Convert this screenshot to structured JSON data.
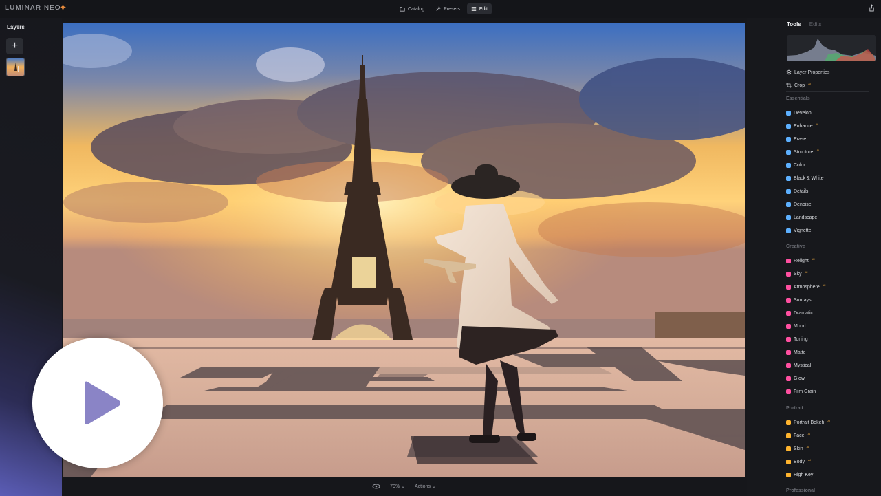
{
  "app": {
    "logo_main": "LUMINAR",
    "logo_sub": "NEO"
  },
  "nav": {
    "catalog": "Catalog",
    "presets": "Presets",
    "edit": "Edit"
  },
  "layers": {
    "title": "Layers",
    "add_label": "+"
  },
  "bottom": {
    "zoom": "79%",
    "actions": "Actions"
  },
  "tabs": {
    "tools": "Tools",
    "edits": "Edits"
  },
  "tools": {
    "layer_properties": "Layer Properties",
    "crop": "Crop",
    "ai_badge": "AI",
    "essentials_title": "Essentials",
    "essentials": [
      {
        "label": "Develop",
        "icon": "develop-icon",
        "color": "#5db0ff",
        "ai": false
      },
      {
        "label": "Enhance",
        "icon": "enhance-icon",
        "color": "#5db0ff",
        "ai": true
      },
      {
        "label": "Erase",
        "icon": "erase-icon",
        "color": "#5db0ff",
        "ai": false
      },
      {
        "label": "Structure",
        "icon": "structure-icon",
        "color": "#5db0ff",
        "ai": true
      },
      {
        "label": "Color",
        "icon": "color-icon",
        "color": "#5db0ff",
        "ai": false
      },
      {
        "label": "Black & White",
        "icon": "bw-icon",
        "color": "#5db0ff",
        "ai": false
      },
      {
        "label": "Details",
        "icon": "details-icon",
        "color": "#5db0ff",
        "ai": false
      },
      {
        "label": "Denoise",
        "icon": "denoise-icon",
        "color": "#5db0ff",
        "ai": false
      },
      {
        "label": "Landscape",
        "icon": "landscape-icon",
        "color": "#5db0ff",
        "ai": false
      },
      {
        "label": "Vignette",
        "icon": "vignette-icon",
        "color": "#5db0ff",
        "ai": false
      }
    ],
    "creative_title": "Creative",
    "creative": [
      {
        "label": "Relight",
        "icon": "relight-icon",
        "color": "#ff4fa0",
        "ai": true
      },
      {
        "label": "Sky",
        "icon": "sky-icon",
        "color": "#ff4fa0",
        "ai": true
      },
      {
        "label": "Atmosphere",
        "icon": "atmosphere-icon",
        "color": "#ff4fa0",
        "ai": true
      },
      {
        "label": "Sunrays",
        "icon": "sunrays-icon",
        "color": "#ff4fa0",
        "ai": false
      },
      {
        "label": "Dramatic",
        "icon": "dramatic-icon",
        "color": "#ff4fa0",
        "ai": false
      },
      {
        "label": "Mood",
        "icon": "mood-icon",
        "color": "#ff4fa0",
        "ai": false
      },
      {
        "label": "Toning",
        "icon": "toning-icon",
        "color": "#ff4fa0",
        "ai": false
      },
      {
        "label": "Matte",
        "icon": "matte-icon",
        "color": "#ff4fa0",
        "ai": false
      },
      {
        "label": "Mystical",
        "icon": "mystical-icon",
        "color": "#ff4fa0",
        "ai": false
      },
      {
        "label": "Glow",
        "icon": "glow-icon",
        "color": "#ff4fa0",
        "ai": false
      },
      {
        "label": "Film Grain",
        "icon": "film-grain-icon",
        "color": "#ff4fa0",
        "ai": false
      }
    ],
    "portrait_title": "Portrait",
    "portrait": [
      {
        "label": "Portrait Bokeh",
        "icon": "portrait-bokeh-icon",
        "color": "#ffb42e",
        "ai": true
      },
      {
        "label": "Face",
        "icon": "face-icon",
        "color": "#ffb42e",
        "ai": true
      },
      {
        "label": "Skin",
        "icon": "skin-icon",
        "color": "#ffb42e",
        "ai": true
      },
      {
        "label": "Body",
        "icon": "body-icon",
        "color": "#ffb42e",
        "ai": true
      },
      {
        "label": "High Key",
        "icon": "high-key-icon",
        "color": "#ffb42e",
        "ai": false
      }
    ],
    "professional_title": "Professional"
  },
  "colors": {
    "accent_ai": "#e9a840",
    "panel": "#17181c"
  }
}
